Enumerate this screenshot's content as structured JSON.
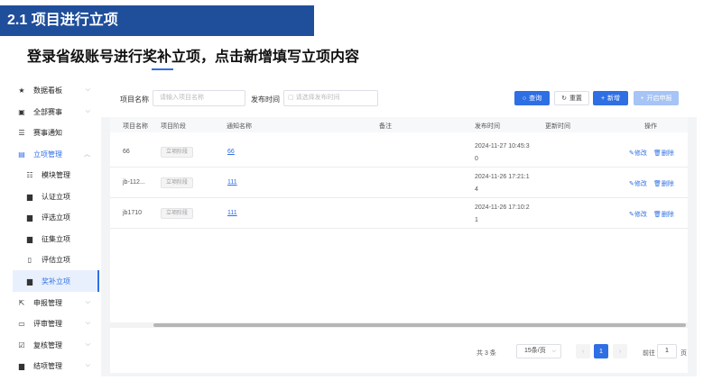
{
  "slide": {
    "section_title": "2.1 项目进行立项",
    "subtitle": "登录省级账号进行奖补立项，点击新增填写立项内容"
  },
  "sidebar": {
    "items": [
      {
        "label": "数据看板",
        "icon": "star-icon",
        "glyph": "★",
        "chevron": "⌵"
      },
      {
        "label": "全部赛事",
        "icon": "calendar-icon",
        "glyph": "▣",
        "chevron": "⌵"
      },
      {
        "label": "赛事通知",
        "icon": "list-icon",
        "glyph": "☰",
        "chevron": ""
      },
      {
        "label": "立项管理",
        "icon": "document-icon",
        "glyph": "▤",
        "chevron": "︿"
      },
      {
        "label": "模块管理",
        "icon": "list-icon",
        "glyph": "☷",
        "chevron": ""
      },
      {
        "label": "认证立项",
        "icon": "file-icon",
        "glyph": "▆",
        "chevron": ""
      },
      {
        "label": "评选立项",
        "icon": "file-icon",
        "glyph": "▆",
        "chevron": ""
      },
      {
        "label": "征集立项",
        "icon": "file-icon",
        "glyph": "▆",
        "chevron": ""
      },
      {
        "label": "评估立项",
        "icon": "document-outline-icon",
        "glyph": "▯",
        "chevron": ""
      },
      {
        "label": "奖补立项",
        "icon": "file-icon",
        "glyph": "▆",
        "chevron": ""
      },
      {
        "label": "申报管理",
        "icon": "external-link-icon",
        "glyph": "⇱",
        "chevron": "⌵"
      },
      {
        "label": "评审管理",
        "icon": "monitor-icon",
        "glyph": "▭",
        "chevron": "⌵"
      },
      {
        "label": "复核管理",
        "icon": "checkbox-icon",
        "glyph": "☑",
        "chevron": "⌵"
      },
      {
        "label": "结项管理",
        "icon": "document-icon",
        "glyph": "▆",
        "chevron": "⌵"
      }
    ]
  },
  "filter": {
    "name_label": "项目名称",
    "name_placeholder": "请输入项目名称",
    "time_label": "发布时间",
    "time_placeholder": "请选择发布时间",
    "calendar_icon": "calendar-icon",
    "search_label": "查询",
    "reset_label": "重置",
    "add_label": "新增",
    "start_label": "开启申报"
  },
  "table": {
    "headers": [
      "项目名称",
      "项目阶段",
      "通知名称",
      "备注",
      "发布时间",
      "更新时间",
      "操作"
    ],
    "rows": [
      {
        "name": "66",
        "stage": "立项阶段",
        "notice": "66",
        "remark": "",
        "time_l1": "2024-11-27 10:45:3",
        "time_l2": "0",
        "updated": "",
        "edit": "修改",
        "delete": "删除"
      },
      {
        "name": "jb-112...",
        "stage": "立项阶段",
        "notice": "111",
        "remark": "",
        "time_l1": "2024-11-26 17:21:1",
        "time_l2": "4",
        "updated": "",
        "edit": "修改",
        "delete": "删除"
      },
      {
        "name": "jb1710",
        "stage": "立项阶段",
        "notice": "111",
        "remark": "",
        "time_l1": "2024-11-26 17:10:2",
        "time_l2": "1",
        "updated": "",
        "edit": "修改",
        "delete": "删除"
      }
    ]
  },
  "pagination": {
    "total": "共 3 条",
    "page_size": "15条/页",
    "prev": "‹",
    "current": "1",
    "next": "›",
    "goto_prefix": "前往",
    "goto_value": "1",
    "goto_suffix": "页"
  },
  "colors": {
    "primary": "#2f6fe4",
    "header": "#1f4e9b"
  }
}
